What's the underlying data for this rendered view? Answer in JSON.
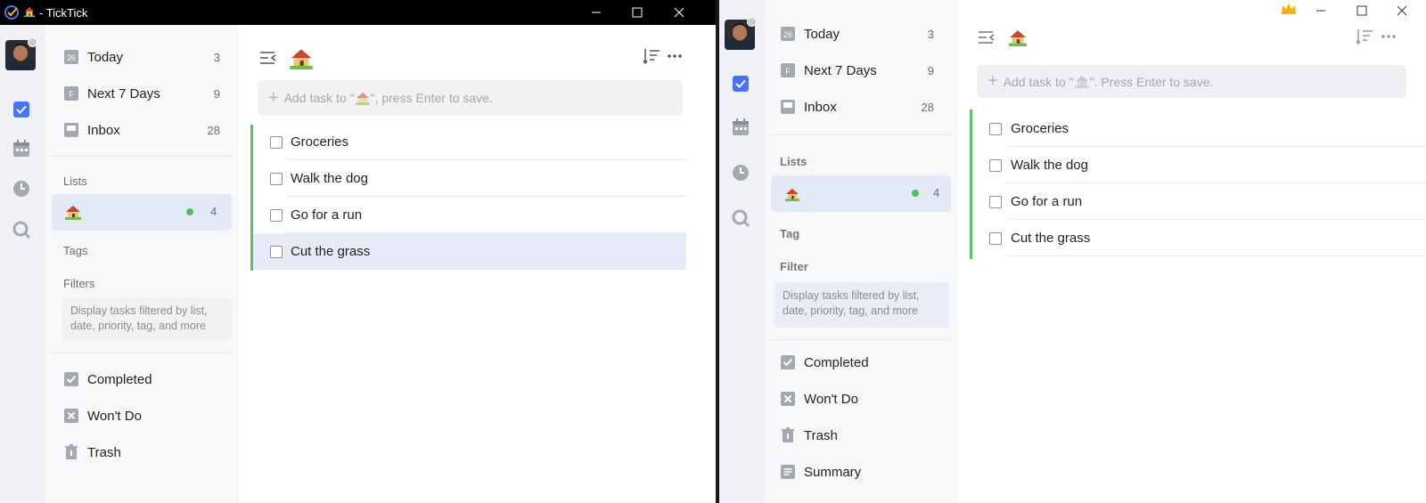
{
  "window_a": {
    "title": "- TickTick",
    "nav": [
      {
        "label": "Today",
        "icon": "calendar-26-icon",
        "icon_text": "26",
        "count": "3"
      },
      {
        "label": "Next 7 Days",
        "icon": "calendar-f-icon",
        "icon_text": "F",
        "count": "9"
      },
      {
        "label": "Inbox",
        "icon": "inbox-icon",
        "count": "28"
      }
    ],
    "lists_heading": "Lists",
    "list_count": "4",
    "tags_heading": "Tags",
    "filters_heading": "Filters",
    "filters_hint": "Display tasks filtered by list, date, priority, tag, and more",
    "footer": [
      {
        "label": "Completed",
        "icon": "check-box-icon"
      },
      {
        "label": "Won't Do",
        "icon": "x-box-icon"
      },
      {
        "label": "Trash",
        "icon": "trash-icon"
      }
    ],
    "add_placeholder_pre": "Add task to \"",
    "add_placeholder_post": "\", press Enter to save.",
    "tasks": [
      "Groceries",
      "Walk the dog",
      "Go for a run",
      "Cut the grass"
    ],
    "selected_task_index": 3
  },
  "window_b": {
    "nav": [
      {
        "label": "Today",
        "icon": "calendar-26-icon",
        "icon_text": "26",
        "count": "3"
      },
      {
        "label": "Next 7 Days",
        "icon": "calendar-f-icon",
        "icon_text": "F",
        "count": "9"
      },
      {
        "label": "Inbox",
        "icon": "inbox-icon",
        "count": "28"
      }
    ],
    "lists_heading": "Lists",
    "list_count": "4",
    "tag_heading": "Tag",
    "filter_heading": "Filter",
    "filter_hint": "Display tasks filtered by list, date, priority, tag, and more",
    "footer": [
      {
        "label": "Completed",
        "icon": "check-box-icon"
      },
      {
        "label": "Won't Do",
        "icon": "x-box-icon"
      },
      {
        "label": "Trash",
        "icon": "trash-icon"
      },
      {
        "label": "Summary",
        "icon": "summary-icon"
      }
    ],
    "add_placeholder_pre": "Add task to \"",
    "add_placeholder_post": "\". Press Enter to save.",
    "tasks": [
      "Groceries",
      "Walk the dog",
      "Go for a run",
      "Cut the grass"
    ]
  },
  "colors": {
    "accent": "#4772fa",
    "list_dot": "#4fbf5b",
    "list_bar": "#5cc165",
    "selected_bg": "#e4e9f7",
    "crown": "#f5b400"
  }
}
